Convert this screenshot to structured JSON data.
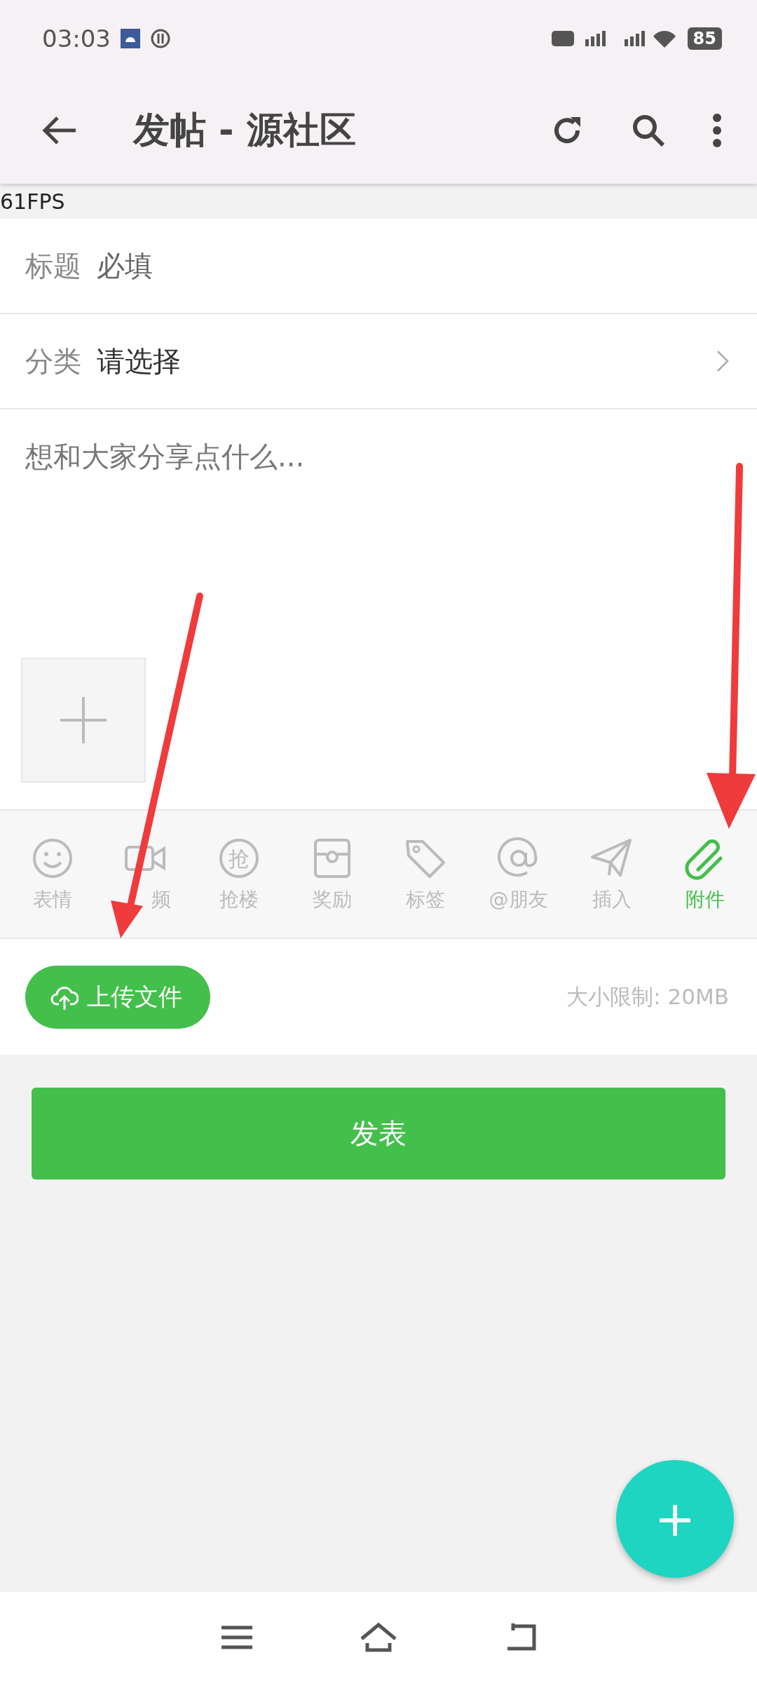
{
  "status_bar": {
    "time": "03:03",
    "battery": "85"
  },
  "app_bar": {
    "title": "发帖 - 源社区"
  },
  "fps": "61FPS",
  "form": {
    "title_field": {
      "label": "标题",
      "placeholder": "必填"
    },
    "category_field": {
      "label": "分类",
      "value": "请选择"
    },
    "content_field": {
      "placeholder": "想和大家分享点什么..."
    }
  },
  "toolbar": [
    {
      "kind": "emoji",
      "label": "表情",
      "selected": false
    },
    {
      "kind": "video",
      "label": "频",
      "selected": false
    },
    {
      "kind": "grab",
      "label": "抢楼",
      "glyph": "抢",
      "selected": false
    },
    {
      "kind": "reward",
      "label": "奖励",
      "selected": false
    },
    {
      "kind": "tag",
      "label": "标签",
      "selected": false
    },
    {
      "kind": "mention",
      "label": "@朋友",
      "selected": false
    },
    {
      "kind": "insert",
      "label": "插入",
      "selected": false
    },
    {
      "kind": "attach",
      "label": "附件",
      "selected": true
    }
  ],
  "upload": {
    "button": "上传文件",
    "limit": "大小限制: 20MB"
  },
  "submit_button": "发表",
  "fab": {
    "label": "+"
  }
}
